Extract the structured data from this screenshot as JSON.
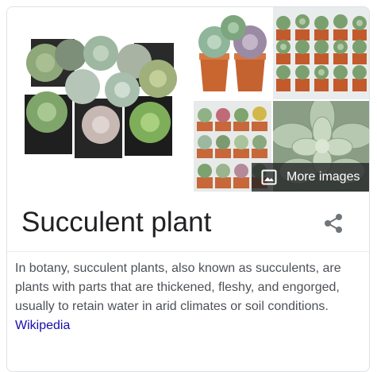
{
  "gallery": {
    "images": [
      {
        "name": "image-potted-succulents-collection",
        "icon": "image-thumbnail"
      },
      {
        "name": "image-two-succulents-orange-pots",
        "icon": "image-thumbnail"
      },
      {
        "name": "image-succulents-in-rows",
        "icon": "image-thumbnail"
      },
      {
        "name": "image-succulent-pots-grid",
        "icon": "image-thumbnail"
      },
      {
        "name": "image-green-rosette-closeup",
        "icon": "image-thumbnail"
      }
    ],
    "more_images_label": "More images",
    "more_images_icon": "image-icon"
  },
  "entity": {
    "title": "Succulent plant",
    "share_icon": "share-icon"
  },
  "description": {
    "text": "In botany, succulent plants, also known as succulents, are plants with parts that are thickened, fleshy, and engorged, usually to retain water in arid climates or soil conditions.",
    "source_link": "Wikipedia"
  },
  "colors": {
    "title_text": "#202124",
    "body_text": "#4d5156",
    "link": "#1a0dab",
    "border": "#dfe1e5"
  }
}
